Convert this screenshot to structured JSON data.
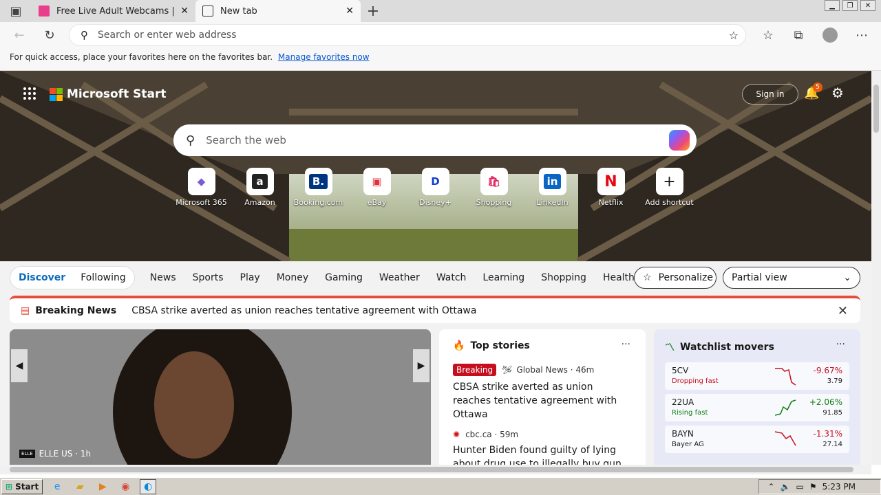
{
  "browser": {
    "tabs": [
      {
        "title": "Free Live Adult Webcams | KumC",
        "active": false
      },
      {
        "title": "New tab",
        "active": true
      }
    ],
    "address_placeholder": "Search or enter web address",
    "favbar_text": "For quick access, place your favorites here on the favorites bar.",
    "favbar_link": "Manage favorites now"
  },
  "start": {
    "logo": "Microsoft Start",
    "sign_in": "Sign in",
    "notification_count": "5",
    "search_placeholder": "Search the web",
    "shortcuts": [
      {
        "label": "Microsoft 365",
        "icon": "m365-icon"
      },
      {
        "label": "Amazon",
        "icon": "amazon-icon"
      },
      {
        "label": "Booking.com",
        "icon": "booking-icon"
      },
      {
        "label": "eBay",
        "icon": "ebay-icon"
      },
      {
        "label": "Disney+",
        "icon": "disney-icon"
      },
      {
        "label": "Shopping",
        "icon": "shopping-icon"
      },
      {
        "label": "LinkedIn",
        "icon": "linkedin-icon"
      },
      {
        "label": "Netflix",
        "icon": "netflix-icon"
      },
      {
        "label": "Add shortcut",
        "icon": "plus-icon"
      }
    ]
  },
  "feed": {
    "tabs": [
      "Discover",
      "Following"
    ],
    "nav": [
      "News",
      "Sports",
      "Play",
      "Money",
      "Gaming",
      "Weather",
      "Watch",
      "Learning",
      "Shopping",
      "Health"
    ],
    "more": "···",
    "personalize": "Personalize",
    "view": "Partial view",
    "breaking_label": "Breaking News",
    "breaking_text": "CBSA strike averted as union reaches tentative agreement with Ottawa",
    "hero_source": "ELLE US · 1h",
    "hero_source_logo": "ELLE"
  },
  "top_stories": {
    "title": "Top stories",
    "items": [
      {
        "tag": "Breaking",
        "source": "Global News · 46m",
        "headline": "CBSA strike averted as union reaches tentative agreement with Ottawa"
      },
      {
        "source": "cbc.ca · 59m",
        "headline": "Hunter Biden found guilty of lying about drug use to illegally buy gun"
      }
    ]
  },
  "watchlist": {
    "title": "Watchlist movers",
    "items": [
      {
        "ticker": "5CV",
        "sub": "Dropping fast",
        "change": "-9.67%",
        "price": "3.79",
        "color": "#c50f1f"
      },
      {
        "ticker": "22UA",
        "sub": "Rising fast",
        "change": "+2.06%",
        "price": "91.85",
        "color": "#107c10"
      },
      {
        "ticker": "BAYN",
        "sub": "Bayer AG",
        "change": "-1.31%",
        "price": "27.14",
        "color": "#c50f1f"
      }
    ]
  },
  "taskbar": {
    "start": "Start",
    "time": "5:23 PM"
  }
}
